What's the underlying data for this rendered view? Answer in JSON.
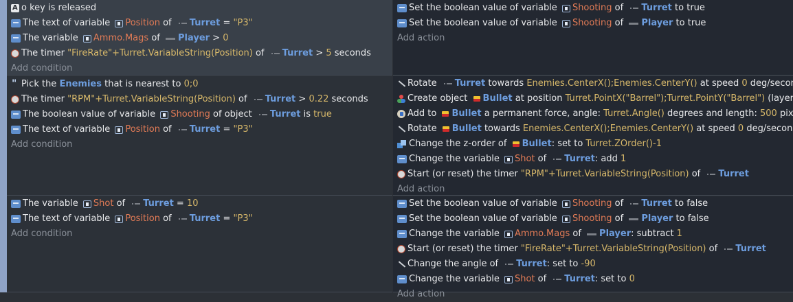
{
  "events": [
    {
      "conditions": [
        {
          "icon": "key-icon",
          "parts": [
            {
              "k": "t",
              "v": "o"
            },
            {
              "k": "t",
              "v": " key is released"
            }
          ]
        },
        {
          "icon": "variable-icon",
          "parts": [
            {
              "k": "t",
              "v": "The text of variable "
            },
            {
              "k": "vicon"
            },
            {
              "k": "v",
              "v": "Position"
            },
            {
              "k": "t",
              "v": " of "
            },
            {
              "k": "obj",
              "o": "turret"
            },
            {
              "k": "o",
              "v": "Turret"
            },
            {
              "k": "t",
              "v": " = "
            },
            {
              "k": "s",
              "v": "\"P3\""
            }
          ]
        },
        {
          "icon": "variable-icon",
          "parts": [
            {
              "k": "t",
              "v": "The variable "
            },
            {
              "k": "vicon"
            },
            {
              "k": "v",
              "v": "Ammo.Mags"
            },
            {
              "k": "t",
              "v": " of "
            },
            {
              "k": "obj",
              "o": "player"
            },
            {
              "k": "o",
              "v": "Player"
            },
            {
              "k": "t",
              "v": " > "
            },
            {
              "k": "s",
              "v": "0"
            }
          ]
        },
        {
          "icon": "timer-icon",
          "parts": [
            {
              "k": "t",
              "v": "The timer "
            },
            {
              "k": "s",
              "v": "\"FireRate\"+Turret.VariableString(Position)"
            },
            {
              "k": "t",
              "v": " of "
            },
            {
              "k": "obj",
              "o": "turret"
            },
            {
              "k": "o",
              "v": "Turret"
            },
            {
              "k": "t",
              "v": " > "
            },
            {
              "k": "s",
              "v": "5"
            },
            {
              "k": "t",
              "v": " seconds"
            }
          ]
        }
      ],
      "add_condition": "Add condition",
      "actions": [
        {
          "icon": "variable-icon",
          "parts": [
            {
              "k": "t",
              "v": "Set the boolean value of variable "
            },
            {
              "k": "vicon"
            },
            {
              "k": "v",
              "v": "Shooting"
            },
            {
              "k": "t",
              "v": " of "
            },
            {
              "k": "obj",
              "o": "turret"
            },
            {
              "k": "o",
              "v": "Turret"
            },
            {
              "k": "t",
              "v": " to true"
            }
          ]
        },
        {
          "icon": "variable-icon",
          "parts": [
            {
              "k": "t",
              "v": "Set the boolean value of variable "
            },
            {
              "k": "vicon"
            },
            {
              "k": "v",
              "v": "Shooting"
            },
            {
              "k": "t",
              "v": " of "
            },
            {
              "k": "obj",
              "o": "player"
            },
            {
              "k": "o",
              "v": "Player"
            },
            {
              "k": "t",
              "v": " to true"
            }
          ]
        }
      ],
      "add_action": "Add action"
    },
    {
      "conditions": [
        {
          "icon": "pick-icon",
          "parts": [
            {
              "k": "t",
              "v": "Pick the "
            },
            {
              "k": "o",
              "v": "Enemies"
            },
            {
              "k": "t",
              "v": " that is nearest to "
            },
            {
              "k": "s",
              "v": "0;0"
            }
          ]
        },
        {
          "icon": "timer-icon",
          "parts": [
            {
              "k": "t",
              "v": "The timer "
            },
            {
              "k": "s",
              "v": "\"RPM\"+Turret.VariableString(Position)"
            },
            {
              "k": "t",
              "v": " of "
            },
            {
              "k": "obj",
              "o": "turret"
            },
            {
              "k": "o",
              "v": "Turret"
            },
            {
              "k": "t",
              "v": " > "
            },
            {
              "k": "s",
              "v": "0.22"
            },
            {
              "k": "t",
              "v": " seconds"
            }
          ]
        },
        {
          "icon": "variable-icon",
          "parts": [
            {
              "k": "t",
              "v": "The boolean value of variable "
            },
            {
              "k": "vicon"
            },
            {
              "k": "v",
              "v": "Shooting"
            },
            {
              "k": "t",
              "v": " of object "
            },
            {
              "k": "obj",
              "o": "turret"
            },
            {
              "k": "o",
              "v": "Turret"
            },
            {
              "k": "t",
              "v": " is "
            },
            {
              "k": "s",
              "v": "true"
            }
          ]
        },
        {
          "icon": "variable-icon",
          "parts": [
            {
              "k": "t",
              "v": "The text of variable "
            },
            {
              "k": "vicon"
            },
            {
              "k": "v",
              "v": "Position"
            },
            {
              "k": "t",
              "v": " of "
            },
            {
              "k": "obj",
              "o": "turret"
            },
            {
              "k": "o",
              "v": "Turret"
            },
            {
              "k": "t",
              "v": " = "
            },
            {
              "k": "s",
              "v": "\"P3\""
            }
          ]
        }
      ],
      "add_condition": "Add condition",
      "actions": [
        {
          "icon": "rotate-icon",
          "parts": [
            {
              "k": "t",
              "v": "Rotate "
            },
            {
              "k": "obj",
              "o": "turret"
            },
            {
              "k": "o",
              "v": "Turret"
            },
            {
              "k": "t",
              "v": " towards "
            },
            {
              "k": "s",
              "v": "Enemies.CenterX();Enemies.CenterY()"
            },
            {
              "k": "t",
              "v": " at speed "
            },
            {
              "k": "s",
              "v": "0"
            },
            {
              "k": "t",
              "v": " deg/second"
            }
          ]
        },
        {
          "icon": "create-icon",
          "parts": [
            {
              "k": "t",
              "v": "Create object "
            },
            {
              "k": "obj",
              "o": "bullet"
            },
            {
              "k": "o",
              "v": "Bullet"
            },
            {
              "k": "t",
              "v": " at position "
            },
            {
              "k": "s",
              "v": "Turret.PointX(\"Barrel\");Turret.PointY(\"Barrel\")"
            },
            {
              "k": "t",
              "v": " (layer: )"
            }
          ]
        },
        {
          "icon": "force-icon",
          "parts": [
            {
              "k": "t",
              "v": "Add to "
            },
            {
              "k": "obj",
              "o": "bullet"
            },
            {
              "k": "o",
              "v": "Bullet"
            },
            {
              "k": "t",
              "v": " a permanent force, angle: "
            },
            {
              "k": "s",
              "v": "Turret.Angle()"
            },
            {
              "k": "t",
              "v": " degrees and length: "
            },
            {
              "k": "s",
              "v": "500"
            },
            {
              "k": "t",
              "v": " pixels"
            }
          ]
        },
        {
          "icon": "rotate-icon",
          "parts": [
            {
              "k": "t",
              "v": "Rotate "
            },
            {
              "k": "obj",
              "o": "bullet"
            },
            {
              "k": "o",
              "v": "Bullet"
            },
            {
              "k": "t",
              "v": " towards "
            },
            {
              "k": "s",
              "v": "Enemies.CenterX();Enemies.CenterY()"
            },
            {
              "k": "t",
              "v": " at speed "
            },
            {
              "k": "s",
              "v": "0"
            },
            {
              "k": "t",
              "v": " deg/second"
            }
          ]
        },
        {
          "icon": "zorder-icon",
          "parts": [
            {
              "k": "t",
              "v": "Change the z-order of "
            },
            {
              "k": "obj",
              "o": "bullet"
            },
            {
              "k": "o",
              "v": "Bullet"
            },
            {
              "k": "t",
              "v": ": set to "
            },
            {
              "k": "s",
              "v": "Turret.ZOrder()-1"
            }
          ]
        },
        {
          "icon": "variable-icon",
          "parts": [
            {
              "k": "t",
              "v": "Change the variable "
            },
            {
              "k": "vicon"
            },
            {
              "k": "v",
              "v": "Shot"
            },
            {
              "k": "t",
              "v": " of "
            },
            {
              "k": "obj",
              "o": "turret"
            },
            {
              "k": "o",
              "v": "Turret"
            },
            {
              "k": "t",
              "v": ": add "
            },
            {
              "k": "s",
              "v": "1"
            }
          ]
        },
        {
          "icon": "timer-icon",
          "parts": [
            {
              "k": "t",
              "v": "Start (or reset) the timer "
            },
            {
              "k": "s",
              "v": "\"RPM\"+Turret.VariableString(Position)"
            },
            {
              "k": "t",
              "v": " of "
            },
            {
              "k": "obj",
              "o": "turret"
            },
            {
              "k": "o",
              "v": "Turret"
            }
          ]
        }
      ],
      "add_action": "Add action"
    },
    {
      "conditions": [
        {
          "icon": "variable-icon",
          "parts": [
            {
              "k": "t",
              "v": "The variable "
            },
            {
              "k": "vicon"
            },
            {
              "k": "v",
              "v": "Shot"
            },
            {
              "k": "t",
              "v": " of "
            },
            {
              "k": "obj",
              "o": "turret"
            },
            {
              "k": "o",
              "v": "Turret"
            },
            {
              "k": "t",
              "v": " = "
            },
            {
              "k": "s",
              "v": "10"
            }
          ]
        },
        {
          "icon": "variable-icon",
          "parts": [
            {
              "k": "t",
              "v": "The text of variable "
            },
            {
              "k": "vicon"
            },
            {
              "k": "v",
              "v": "Position"
            },
            {
              "k": "t",
              "v": " of "
            },
            {
              "k": "obj",
              "o": "turret"
            },
            {
              "k": "o",
              "v": "Turret"
            },
            {
              "k": "t",
              "v": " = "
            },
            {
              "k": "s",
              "v": "\"P3\""
            }
          ]
        }
      ],
      "add_condition": "Add condition",
      "actions": [
        {
          "icon": "variable-icon",
          "parts": [
            {
              "k": "t",
              "v": "Set the boolean value of variable "
            },
            {
              "k": "vicon"
            },
            {
              "k": "v",
              "v": "Shooting"
            },
            {
              "k": "t",
              "v": " of "
            },
            {
              "k": "obj",
              "o": "turret"
            },
            {
              "k": "o",
              "v": "Turret"
            },
            {
              "k": "t",
              "v": " to false"
            }
          ]
        },
        {
          "icon": "variable-icon",
          "parts": [
            {
              "k": "t",
              "v": "Set the boolean value of variable "
            },
            {
              "k": "vicon"
            },
            {
              "k": "v",
              "v": "Shooting"
            },
            {
              "k": "t",
              "v": " of "
            },
            {
              "k": "obj",
              "o": "player"
            },
            {
              "k": "o",
              "v": "Player"
            },
            {
              "k": "t",
              "v": " to false"
            }
          ]
        },
        {
          "icon": "variable-icon",
          "parts": [
            {
              "k": "t",
              "v": "Change the variable "
            },
            {
              "k": "vicon"
            },
            {
              "k": "v",
              "v": "Ammo.Mags"
            },
            {
              "k": "t",
              "v": " of "
            },
            {
              "k": "obj",
              "o": "player"
            },
            {
              "k": "o",
              "v": "Player"
            },
            {
              "k": "t",
              "v": ": subtract "
            },
            {
              "k": "s",
              "v": "1"
            }
          ]
        },
        {
          "icon": "timer-icon",
          "parts": [
            {
              "k": "t",
              "v": "Start (or reset) the timer "
            },
            {
              "k": "s",
              "v": "\"FireRate\"+Turret.VariableString(Position)"
            },
            {
              "k": "t",
              "v": " of "
            },
            {
              "k": "obj",
              "o": "turret"
            },
            {
              "k": "o",
              "v": "Turret"
            }
          ]
        },
        {
          "icon": "rotate-icon",
          "parts": [
            {
              "k": "t",
              "v": "Change the angle of "
            },
            {
              "k": "obj",
              "o": "turret"
            },
            {
              "k": "o",
              "v": "Turret"
            },
            {
              "k": "t",
              "v": ": set to "
            },
            {
              "k": "s",
              "v": "-90"
            }
          ]
        },
        {
          "icon": "variable-icon",
          "parts": [
            {
              "k": "t",
              "v": "Change the variable "
            },
            {
              "k": "vicon"
            },
            {
              "k": "v",
              "v": "Shot"
            },
            {
              "k": "t",
              "v": " of "
            },
            {
              "k": "obj",
              "o": "turret"
            },
            {
              "k": "o",
              "v": "Turret"
            },
            {
              "k": "t",
              "v": ": set to "
            },
            {
              "k": "s",
              "v": "0"
            }
          ]
        }
      ],
      "add_action": "Add action"
    }
  ]
}
